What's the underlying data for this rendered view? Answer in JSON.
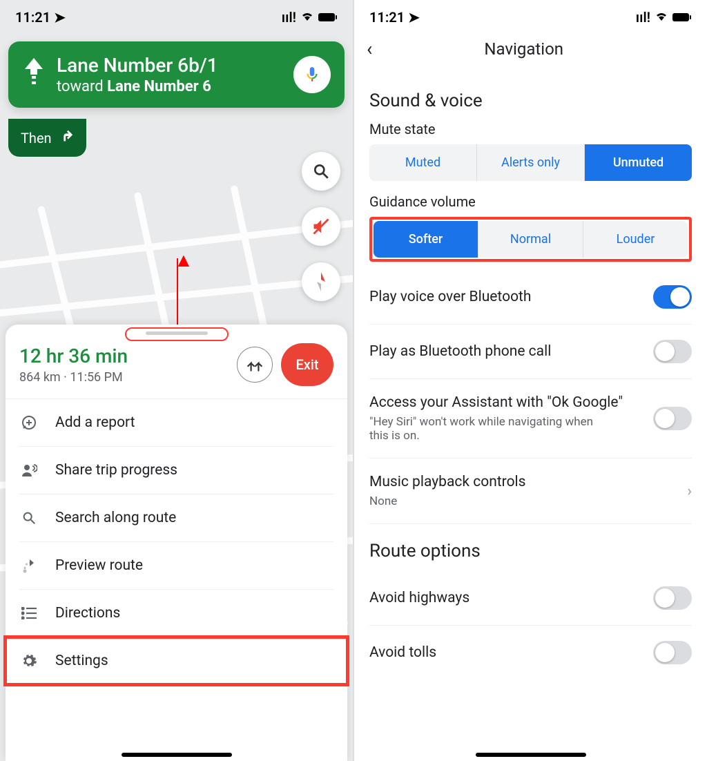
{
  "status": {
    "time": "11:21"
  },
  "left": {
    "banner": {
      "title": "Lane Number 6b/1",
      "toward_prefix": "toward ",
      "toward": "Lane Number 6"
    },
    "then": "Then",
    "eta_duration": "12 hr 36 min",
    "eta_sub": "864 km · 11:56 PM",
    "exit": "Exit",
    "menu": {
      "report": "Add a report",
      "share": "Share trip progress",
      "search": "Search along route",
      "preview": "Preview route",
      "directions": "Directions",
      "settings": "Settings"
    }
  },
  "right": {
    "header": "Navigation",
    "section_sound": "Sound & voice",
    "mute_state_label": "Mute state",
    "mute_state": {
      "muted": "Muted",
      "alerts": "Alerts only",
      "unmuted": "Unmuted"
    },
    "volume_label": "Guidance volume",
    "volume": {
      "softer": "Softer",
      "normal": "Normal",
      "louder": "Louder"
    },
    "bluetooth": "Play voice over Bluetooth",
    "bt_call": "Play as Bluetooth phone call",
    "assistant_title": "Access your Assistant with \"Ok Google\"",
    "assistant_sub": "\"Hey Siri\" won't work while navigating when this is on.",
    "music_title": "Music playback controls",
    "music_value": "None",
    "section_route": "Route options",
    "avoid_highways": "Avoid highways",
    "avoid_tolls": "Avoid tolls"
  }
}
